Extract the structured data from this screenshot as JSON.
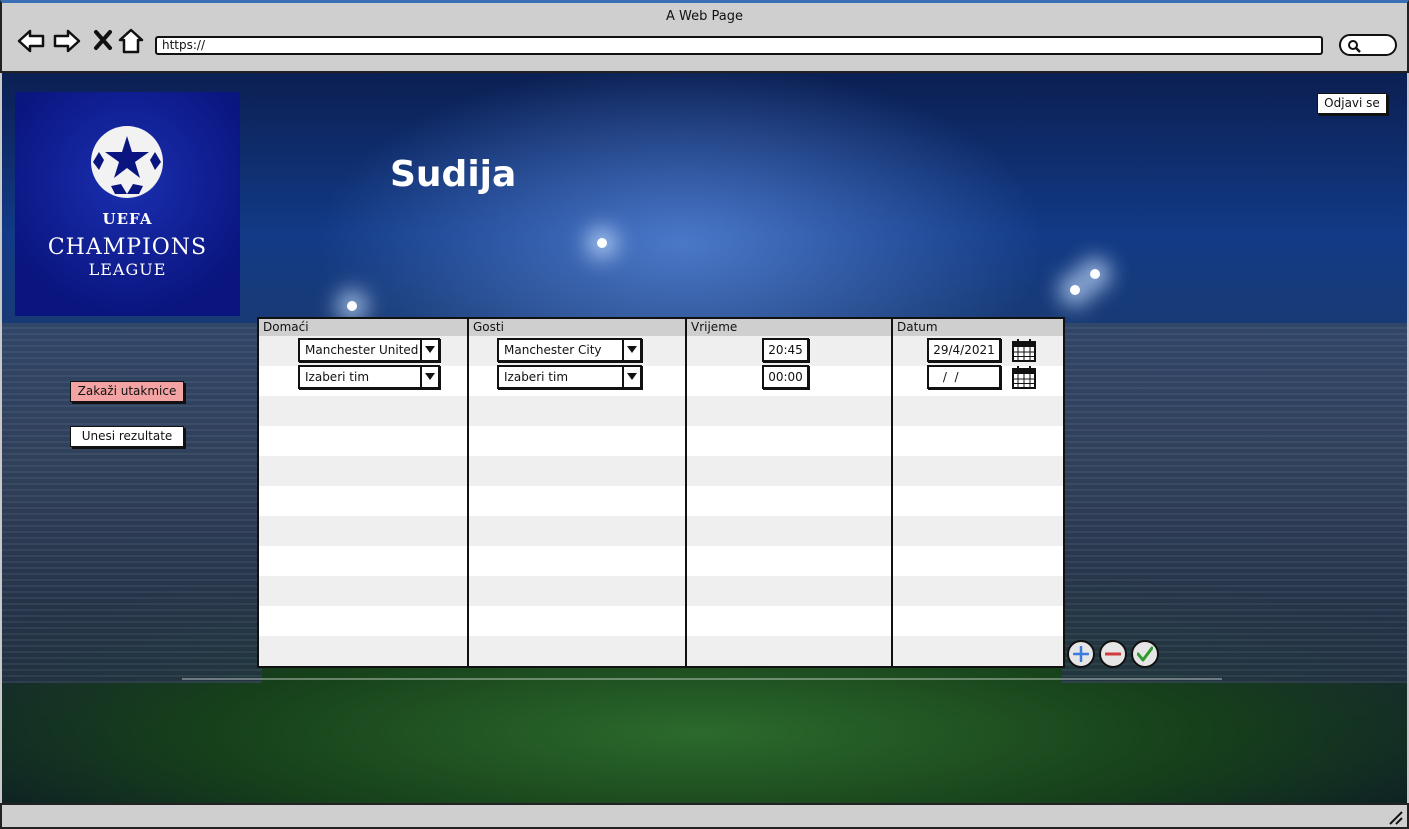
{
  "window": {
    "title": "A Web Page",
    "url": "https://"
  },
  "header": {
    "page_title": "Sudija",
    "logout_label": "Odjavi se"
  },
  "logo": {
    "line1": "UEFA",
    "line2": "CHAMPIONS",
    "line3": "LEAGUE"
  },
  "sidebar": {
    "schedule_label": "Zakaži utakmice",
    "results_label": "Unesi rezultate"
  },
  "table": {
    "columns": [
      "Domaći",
      "Gosti",
      "Vrijeme",
      "Datum"
    ],
    "rows": [
      {
        "home": "Manchester United",
        "away": "Manchester City",
        "time": "20:45",
        "date": "29/4/2021"
      },
      {
        "home": "Izaberi tim",
        "away": "Izaberi tim",
        "time": "00:00",
        "date": " /  /"
      }
    ]
  },
  "actions": {
    "add": "add-icon",
    "remove": "remove-icon",
    "confirm": "check-icon"
  },
  "colors": {
    "schedule_button": "#f3a3a3",
    "add": "#3a7be0",
    "remove": "#d23b3b",
    "confirm": "#2f9a2f"
  }
}
